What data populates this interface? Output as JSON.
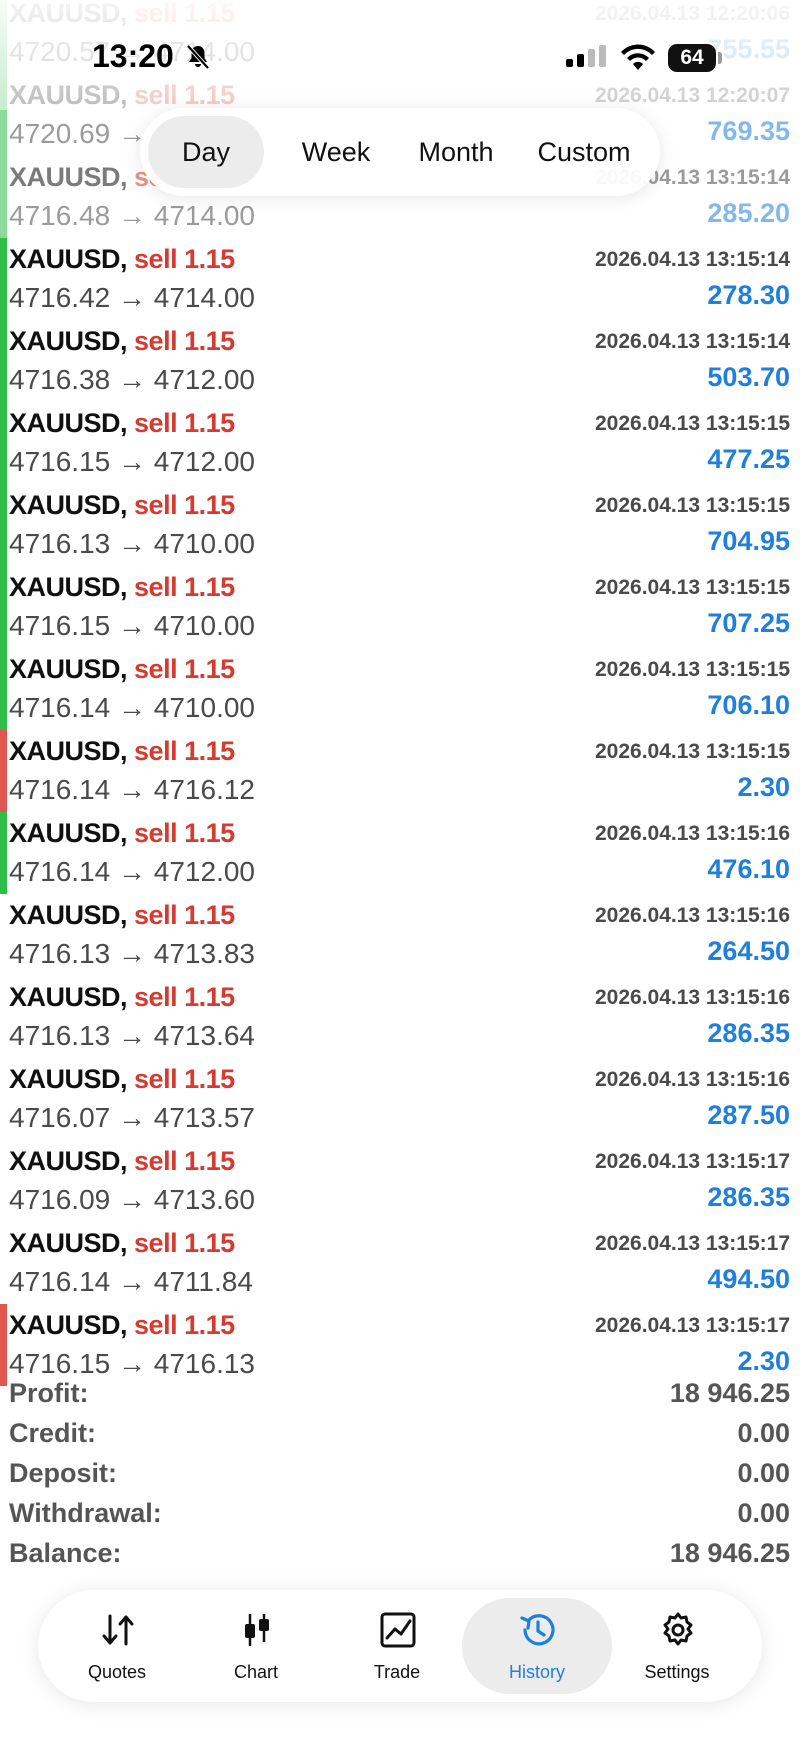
{
  "status_bar": {
    "time": "13:20",
    "battery": "64"
  },
  "period_tabs": [
    {
      "label": "Day",
      "active": true
    },
    {
      "label": "Week",
      "active": false
    },
    {
      "label": "Month",
      "active": false
    },
    {
      "label": "Custom",
      "active": false
    }
  ],
  "deals": [
    {
      "symbol": "XAUUSD",
      "side": "sell",
      "volume": "1.15",
      "open": "4720.57",
      "close": "4714.00",
      "time": "2026.04.13 12:20:06",
      "profit": "755.55",
      "result": "win"
    },
    {
      "symbol": "XAUUSD",
      "side": "sell",
      "volume": "1.15",
      "open": "4720.69",
      "close": "4714.00",
      "time": "2026.04.13 12:20:07",
      "profit": "769.35",
      "result": "win"
    },
    {
      "symbol": "XAUUSD",
      "side": "sell",
      "volume": "1.15",
      "open": "4716.48",
      "close": "4714.00",
      "time": "2026.04.13 13:15:14",
      "profit": "285.20",
      "result": "win"
    },
    {
      "symbol": "XAUUSD",
      "side": "sell",
      "volume": "1.15",
      "open": "4716.42",
      "close": "4714.00",
      "time": "2026.04.13 13:15:14",
      "profit": "278.30",
      "result": "win"
    },
    {
      "symbol": "XAUUSD",
      "side": "sell",
      "volume": "1.15",
      "open": "4716.38",
      "close": "4712.00",
      "time": "2026.04.13 13:15:14",
      "profit": "503.70",
      "result": "win"
    },
    {
      "symbol": "XAUUSD",
      "side": "sell",
      "volume": "1.15",
      "open": "4716.15",
      "close": "4712.00",
      "time": "2026.04.13 13:15:15",
      "profit": "477.25",
      "result": "win"
    },
    {
      "symbol": "XAUUSD",
      "side": "sell",
      "volume": "1.15",
      "open": "4716.13",
      "close": "4710.00",
      "time": "2026.04.13 13:15:15",
      "profit": "704.95",
      "result": "win"
    },
    {
      "symbol": "XAUUSD",
      "side": "sell",
      "volume": "1.15",
      "open": "4716.15",
      "close": "4710.00",
      "time": "2026.04.13 13:15:15",
      "profit": "707.25",
      "result": "win"
    },
    {
      "symbol": "XAUUSD",
      "side": "sell",
      "volume": "1.15",
      "open": "4716.14",
      "close": "4710.00",
      "time": "2026.04.13 13:15:15",
      "profit": "706.10",
      "result": "win"
    },
    {
      "symbol": "XAUUSD",
      "side": "sell",
      "volume": "1.15",
      "open": "4716.14",
      "close": "4716.12",
      "time": "2026.04.13 13:15:15",
      "profit": "2.30",
      "result": "loss"
    },
    {
      "symbol": "XAUUSD",
      "side": "sell",
      "volume": "1.15",
      "open": "4716.14",
      "close": "4712.00",
      "time": "2026.04.13 13:15:16",
      "profit": "476.10",
      "result": "win"
    },
    {
      "symbol": "XAUUSD",
      "side": "sell",
      "volume": "1.15",
      "open": "4716.13",
      "close": "4713.83",
      "time": "2026.04.13 13:15:16",
      "profit": "264.50",
      "result": "none"
    },
    {
      "symbol": "XAUUSD",
      "side": "sell",
      "volume": "1.15",
      "open": "4716.13",
      "close": "4713.64",
      "time": "2026.04.13 13:15:16",
      "profit": "286.35",
      "result": "none"
    },
    {
      "symbol": "XAUUSD",
      "side": "sell",
      "volume": "1.15",
      "open": "4716.07",
      "close": "4713.57",
      "time": "2026.04.13 13:15:16",
      "profit": "287.50",
      "result": "none"
    },
    {
      "symbol": "XAUUSD",
      "side": "sell",
      "volume": "1.15",
      "open": "4716.09",
      "close": "4713.60",
      "time": "2026.04.13 13:15:17",
      "profit": "286.35",
      "result": "none"
    },
    {
      "symbol": "XAUUSD",
      "side": "sell",
      "volume": "1.15",
      "open": "4716.14",
      "close": "4711.84",
      "time": "2026.04.13 13:15:17",
      "profit": "494.50",
      "result": "none"
    },
    {
      "symbol": "XAUUSD",
      "side": "sell",
      "volume": "1.15",
      "open": "4716.15",
      "close": "4716.13",
      "time": "2026.04.13 13:15:17",
      "profit": "2.30",
      "result": "loss"
    }
  ],
  "summary": [
    {
      "label": "Profit:",
      "value": "18 946.25"
    },
    {
      "label": "Credit:",
      "value": "0.00"
    },
    {
      "label": "Deposit:",
      "value": "0.00"
    },
    {
      "label": "Withdrawal:",
      "value": "0.00"
    },
    {
      "label": "Balance:",
      "value": "18 946.25"
    }
  ],
  "tabs": [
    {
      "label": "Quotes",
      "icon": "quotes-arrows-icon",
      "active": false
    },
    {
      "label": "Chart",
      "icon": "candlestick-icon",
      "active": false
    },
    {
      "label": "Trade",
      "icon": "trade-chart-icon",
      "active": false
    },
    {
      "label": "History",
      "icon": "history-clock-icon",
      "active": true
    },
    {
      "label": "Settings",
      "icon": "gear-icon",
      "active": false
    }
  ],
  "colors": {
    "win_bar": "#2fbe4a",
    "loss_bar": "#e0574f",
    "sell": "#d63b30",
    "profit": "#1f7fdd",
    "active_tab": "#1f7fdd"
  }
}
